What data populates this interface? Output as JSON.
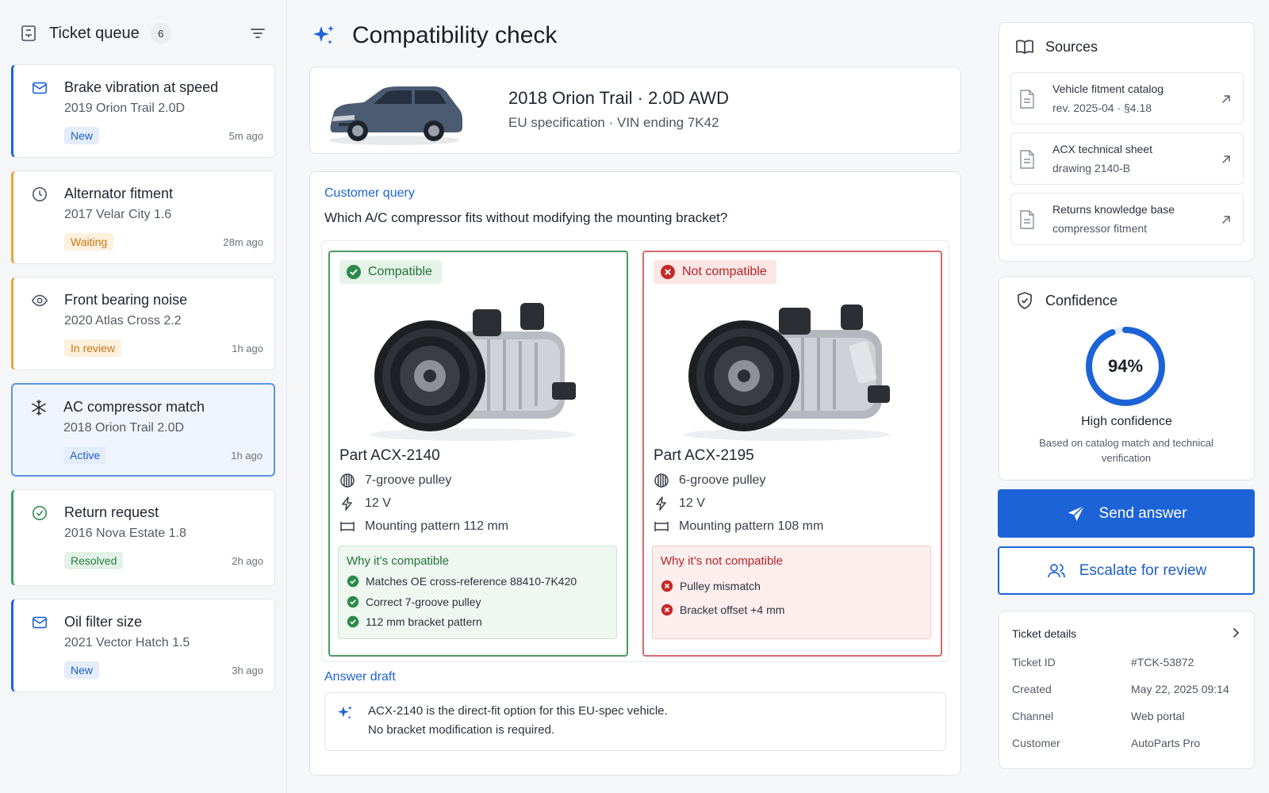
{
  "queue": {
    "title": "Ticket queue",
    "count": "6",
    "tickets": [
      {
        "name": "Brake vibration at speed",
        "vehicle": "2019 Orion Trail 2.0D",
        "badge": "New",
        "time": "5m ago",
        "icon": "mail-icon"
      },
      {
        "name": "Alternator fitment",
        "vehicle": "2017 Velar City 1.6",
        "badge": "Waiting",
        "time": "28m ago",
        "icon": "clock-icon"
      },
      {
        "name": "Front bearing noise",
        "vehicle": "2020 Atlas Cross 2.2",
        "badge": "In review",
        "time": "1h ago",
        "icon": "eye-icon"
      },
      {
        "name": "AC compressor match",
        "vehicle": "2018 Orion Trail 2.0D",
        "badge": "Active",
        "time": "1h ago",
        "icon": "snowflake-icon"
      },
      {
        "name": "Return request",
        "vehicle": "2016 Nova Estate 1.8",
        "badge": "Resolved",
        "time": "2h ago",
        "icon": "check-circle-icon"
      },
      {
        "name": "Oil filter size",
        "vehicle": "2021 Vector Hatch 1.5",
        "badge": "New",
        "time": "3h ago",
        "icon": "mail-icon"
      }
    ]
  },
  "main": {
    "title": "Compatibility check",
    "vehicle": {
      "name": "2018 Orion Trail · 2.0D AWD",
      "sub": "EU specification · VIN ending 7K42"
    },
    "query_label": "Customer query",
    "query_text": "Which A/C compressor fits without modifying the mounting bracket?",
    "parts": [
      {
        "status": "Compatible",
        "name": "Part ACX-2140",
        "specs": [
          "7-groove pulley",
          "12 V",
          "Mounting pattern 112 mm"
        ],
        "why_title": "Why it’s compatible",
        "reasons": [
          "Matches OE cross-reference 88410-7K420",
          "Correct 7-groove pulley",
          "112 mm bracket pattern"
        ]
      },
      {
        "status": "Not compatible",
        "name": "Part ACX-2195",
        "specs": [
          "6-groove pulley",
          "12 V",
          "Mounting pattern 108 mm"
        ],
        "why_title": "Why it’s not compatible",
        "reasons": [
          "Pulley mismatch",
          "Bracket offset +4 mm"
        ]
      }
    ],
    "draft_label": "Answer draft",
    "draft_line1": "ACX-2140 is the direct-fit option for this EU-spec vehicle.",
    "draft_line2": "No bracket modification is required."
  },
  "sources": {
    "title": "Sources",
    "items": [
      {
        "line1": "Vehicle fitment catalog",
        "line2": "rev. 2025-04 · §4.18"
      },
      {
        "line1": "ACX technical sheet",
        "line2": "drawing 2140-B"
      },
      {
        "line1": "Returns knowledge base",
        "line2": "compressor fitment"
      }
    ]
  },
  "confidence": {
    "title": "Confidence",
    "value": "94%",
    "fraction": 0.94,
    "label": "High confidence",
    "note": "Based on catalog match and technical verification"
  },
  "actions": {
    "send": "Send answer",
    "escalate": "Escalate for review"
  },
  "details": {
    "title": "Ticket details",
    "rows": [
      {
        "key": "Ticket ID",
        "value": "#TCK-53872"
      },
      {
        "key": "Created",
        "value": "May 22, 2025 09:14"
      },
      {
        "key": "Channel",
        "value": "Web portal"
      },
      {
        "key": "Customer",
        "value": "AutoParts Pro"
      }
    ]
  },
  "colors": {
    "accent": "#1d63d8",
    "success": "#3aa35c",
    "danger": "#d0393a",
    "warning": "#f0a23a"
  }
}
